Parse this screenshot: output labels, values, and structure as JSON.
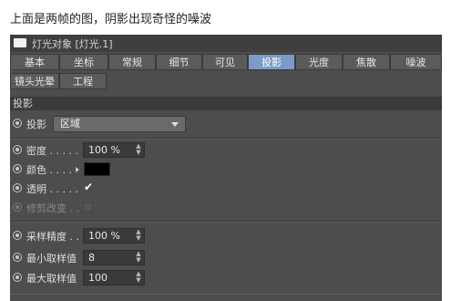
{
  "caption": "上面是两帧的图，阴影出现奇怪的噪波",
  "window": {
    "title": "灯光对象 [灯光.1]",
    "title_icon": "panel-icon"
  },
  "tabs": [
    {
      "label": "基本",
      "active": false
    },
    {
      "label": "坐标",
      "active": false
    },
    {
      "label": "常规",
      "active": false
    },
    {
      "label": "细节",
      "active": false
    },
    {
      "label": "可见",
      "active": false
    },
    {
      "label": "投影",
      "active": true
    },
    {
      "label": "光度",
      "active": false
    },
    {
      "label": "焦散",
      "active": false
    },
    {
      "label": "噪波",
      "active": false
    },
    {
      "label": "镜头光晕",
      "active": false
    },
    {
      "label": "工程",
      "active": false
    }
  ],
  "section": {
    "title": "投影"
  },
  "shadow": {
    "label": "投影",
    "value": "区域"
  },
  "params": {
    "density": {
      "label": "密度 . . . . .",
      "value": "100 %"
    },
    "color": {
      "label": "颜色 . . . .",
      "value": "#000000"
    },
    "transparency": {
      "label": "透明 . . . . .",
      "checked": true
    },
    "clipping": {
      "label": "修剪改变 . .",
      "checked": false,
      "disabled": true
    }
  },
  "sampling": {
    "accuracy": {
      "label": "采样精度 . .",
      "value": "100 %"
    },
    "min_samples": {
      "label": "最小取样值",
      "value": "8"
    },
    "max_samples": {
      "label": "最大取样值",
      "value": "100"
    }
  },
  "colors": {
    "panel": "#4d4d4d",
    "active_tab": "#7a9cc6"
  }
}
